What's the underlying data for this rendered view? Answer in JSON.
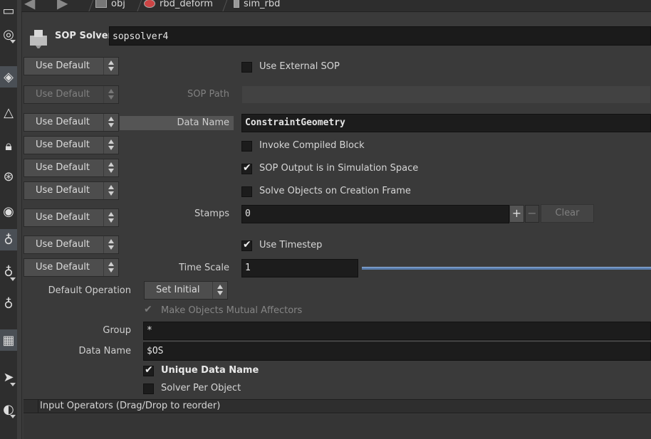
{
  "breadcrumb": {
    "items": [
      "obj",
      "rbd_deform",
      "sim_rbd"
    ]
  },
  "header": {
    "node_type": "SOP Solver",
    "node_name": "sopsolver4"
  },
  "use_default_label": "Use Default",
  "params": {
    "use_external_sop": {
      "label": "Use External SOP",
      "checked": false
    },
    "sop_path": {
      "label": "SOP Path",
      "value": ""
    },
    "data_name": {
      "label": "Data Name",
      "value": "ConstraintGeometry"
    },
    "invoke_compiled_block": {
      "label": "Invoke Compiled Block",
      "checked": false
    },
    "sop_output_sim_space": {
      "label": "SOP Output is in Simulation Space",
      "checked": true
    },
    "solve_on_creation": {
      "label": "Solve Objects on Creation Frame",
      "checked": false
    },
    "stamps": {
      "label": "Stamps",
      "value": "0",
      "plus": "+",
      "minus": "−",
      "clear": "Clear"
    },
    "use_timestep": {
      "label": "Use Timestep",
      "checked": true
    },
    "time_scale": {
      "label": "Time Scale",
      "value": "1"
    },
    "default_operation": {
      "label": "Default Operation",
      "value": "Set Initial"
    },
    "mutual_affectors": {
      "label": "Make Objects Mutual Affectors",
      "checked": true,
      "enabled": false
    },
    "group": {
      "label": "Group",
      "value": "*"
    },
    "data_name2": {
      "label": "Data Name",
      "value": "$OS"
    },
    "unique_data_name": {
      "label": "Unique Data Name",
      "checked": true
    },
    "solver_per_object": {
      "label": "Solver Per Object",
      "checked": false
    }
  },
  "input_operators": {
    "label": "Input Operators (Drag/Drop to reorder)"
  },
  "left_toolbar": [
    "select-tool-icon",
    "help-icon",
    "view-tool-icon",
    "pose-tool-icon",
    "lock-icon",
    "light-icon",
    "camera-icon",
    "bulb-icon",
    "bulb-icon-2",
    "bulb-icon-3",
    "cube-icon",
    "eye-icon",
    "eye-icon-2"
  ]
}
